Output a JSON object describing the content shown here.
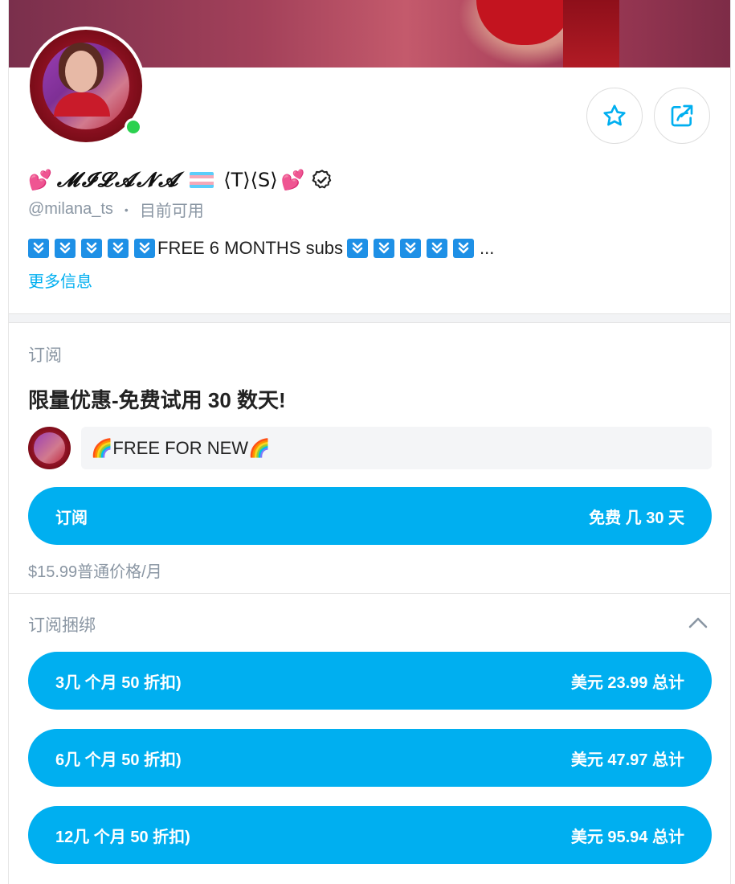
{
  "profile": {
    "name_prefix_emoji": "💕",
    "name_script": "𝓜𝓘𝓛𝓐𝓝𝓐",
    "name_suffix": "⟨T⟩⟨S⟩",
    "name_suffix_emoji": "💕",
    "handle": "@milana_ts",
    "status": "目前可用",
    "bio": "FREE 6 MONTHS subs",
    "bio_ellipsis": "...",
    "more_info": "更多信息"
  },
  "subscription": {
    "section_title": "订阅",
    "promo_title": "限量优惠-免费试用 30 数天!",
    "message": "🌈FREE FOR NEW🌈",
    "button_label": "订阅",
    "button_price": "免费 几 30 天",
    "regular_price": "$15.99普通价格/月"
  },
  "bundles": {
    "section_title": "订阅捆绑",
    "items": [
      {
        "label": "3几 个月 50 折扣)",
        "price": "美元 23.99 总计"
      },
      {
        "label": "6几 个月 50 折扣)",
        "price": "美元 47.97 总计"
      },
      {
        "label": "12几 个月 50 折扣)",
        "price": "美元 95.94 总计"
      }
    ]
  },
  "colors": {
    "accent": "#00aff0",
    "online": "#2bd14f",
    "muted_text": "#8a96a3"
  },
  "icons": {
    "favorite": "star-icon",
    "share": "share-icon",
    "verified": "verified-badge-icon",
    "collapse": "chevron-up-icon",
    "bio_arrows": "double-down-arrow-icon"
  }
}
